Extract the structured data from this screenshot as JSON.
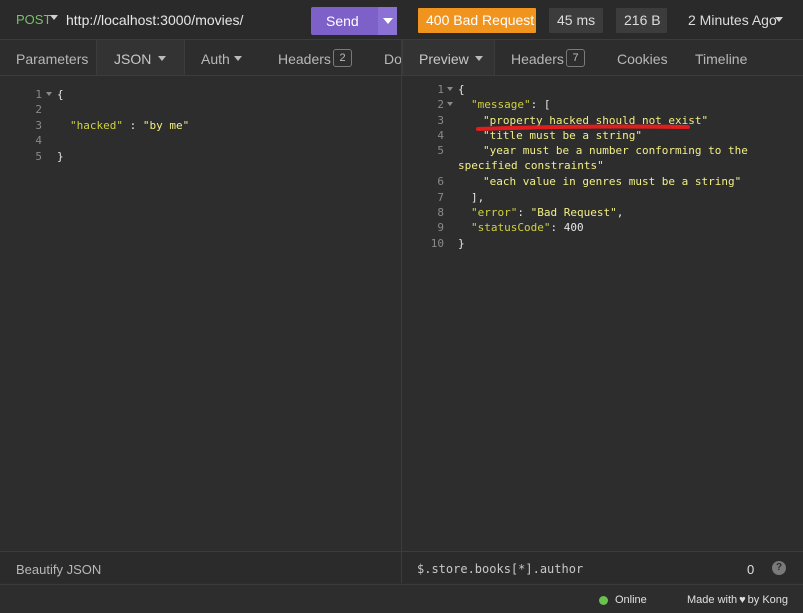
{
  "request": {
    "method": "POST",
    "url": "http://localhost:3000/movies/",
    "send_label": "Send"
  },
  "response": {
    "status": "400 Bad Request",
    "time": "45 ms",
    "size": "216 B",
    "age": "2 Minutes Ago"
  },
  "request_tabs": [
    {
      "label": "Parameters"
    },
    {
      "label": "JSON"
    },
    {
      "label": "Auth"
    },
    {
      "label": "Headers",
      "badge": "2"
    },
    {
      "label": "Do"
    }
  ],
  "response_tabs": [
    {
      "label": "Preview"
    },
    {
      "label": "Headers",
      "badge": "7"
    },
    {
      "label": "Cookies"
    },
    {
      "label": "Timeline"
    }
  ],
  "request_body": {
    "line_numbers": [
      "1",
      "2",
      "3",
      "4",
      "5"
    ],
    "open_brace": "{",
    "key": "\"hacked\"",
    "sep": " : ",
    "value": "\"by me\"",
    "close_brace": "}"
  },
  "response_body": {
    "line_numbers": [
      "1",
      "2",
      "3",
      "4",
      "5",
      "",
      "6",
      "7",
      "8",
      "9",
      "10"
    ],
    "l1": "{",
    "message_key": "\"message\"",
    "l2_rest": ": [",
    "msg1": "\"property hacked should not exist\"",
    "msg2": "\"title must be a string\"",
    "msg3a": "\"year must be a number conforming to the",
    "msg3b": "specified constraints\"",
    "msg4": "\"each value in genres must be a string\"",
    "l7": "],",
    "error_key": "\"error\"",
    "error_value": "\"Bad Request\"",
    "status_key": "\"statusCode\"",
    "status_value": "400",
    "l10": "}"
  },
  "bottom": {
    "beautify_label": "Beautify JSON",
    "filter_text": "$.store.books[*].author",
    "count": "0",
    "help": "?"
  },
  "footer": {
    "online": "Online",
    "made_prefix": "Made with",
    "made_suffix": "by Kong"
  },
  "colors": {
    "method": "#78c06a",
    "send": "#7e60c9",
    "status_error": "#f0941e",
    "json_key": "#cfd13f",
    "json_string": "#f2ef86",
    "annotation": "#e01e1e",
    "online": "#6bc14e"
  },
  "icons": [
    "method-caret-icon",
    "send-dropdown-icon",
    "time-caret-icon",
    "tab-caret-icon",
    "help-icon",
    "heart-icon",
    "fold-caret-icon"
  ]
}
